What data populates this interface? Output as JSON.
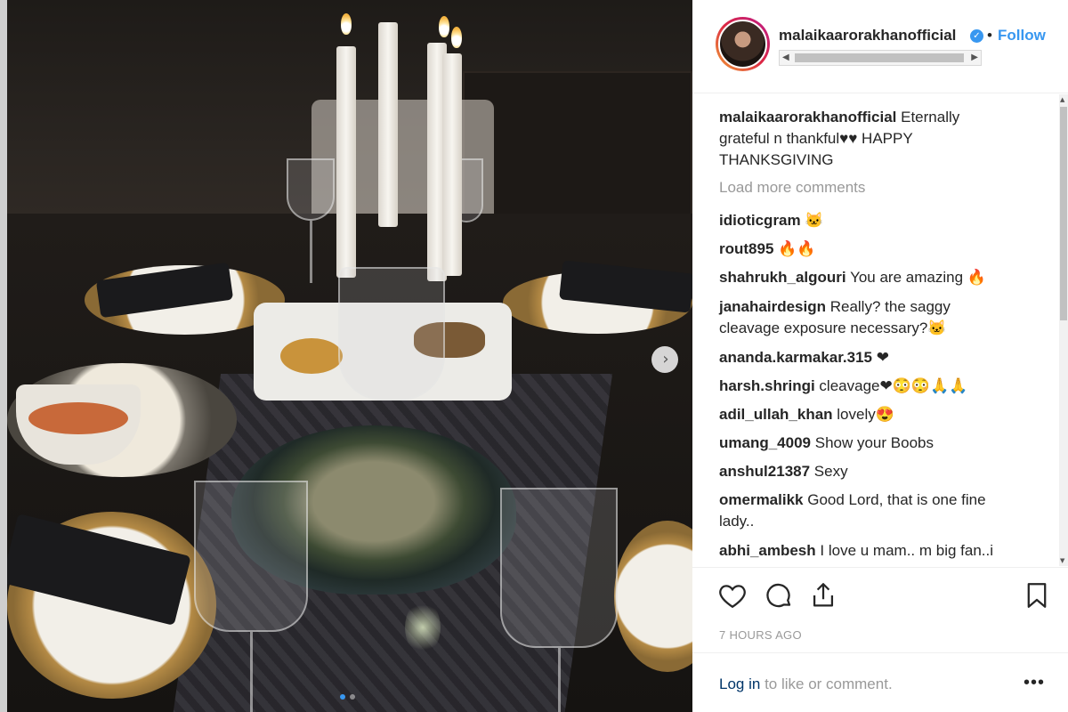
{
  "post": {
    "username": "malaikaarorakhanofficial",
    "follow_label": "Follow",
    "caption_user": "malaikaarorakhanofficial",
    "caption_text": "Eternally grateful n thankful♥♥ HAPPY THANKSGIVING",
    "load_more": "Load more comments",
    "timestamp": "7 HOURS AGO",
    "login_link": "Log in",
    "login_rest": "to like or comment."
  },
  "comments": [
    {
      "user": "idioticgram",
      "text": "🐱"
    },
    {
      "user": "rout895",
      "text": "🔥🔥"
    },
    {
      "user": "shahrukh_algouri",
      "text": "You are amazing 🔥"
    },
    {
      "user": "janahairdesign",
      "text": "Really? the saggy cleavage exposure necessary?🐱"
    },
    {
      "user": "ananda.karmakar.315",
      "text": "❤"
    },
    {
      "user": "harsh.shringi",
      "text": "cleavage❤😳😳🙏🙏"
    },
    {
      "user": "adil_ullah_khan",
      "text": "lovely😍"
    },
    {
      "user": "umang_4009",
      "text": "Show your Boobs"
    },
    {
      "user": "anshul21387",
      "text": "Sexy"
    },
    {
      "user": "omermalikk",
      "text": "Good Lord, that is one fine lady.."
    },
    {
      "user": "abhi_ambesh",
      "text": "I love u mam.. m big fan..i"
    }
  ],
  "icons": {
    "verified": "verified-badge-icon",
    "like": "heart-icon",
    "comment": "speech-bubble-icon",
    "share": "share-icon",
    "save": "bookmark-icon",
    "more": "more-options-icon",
    "next": "chevron-right-icon"
  },
  "colors": {
    "link": "#3897f0",
    "login_link": "#003569",
    "muted": "#999999",
    "text": "#262626"
  },
  "carousel": {
    "slides": 2,
    "active_slide": 1
  }
}
